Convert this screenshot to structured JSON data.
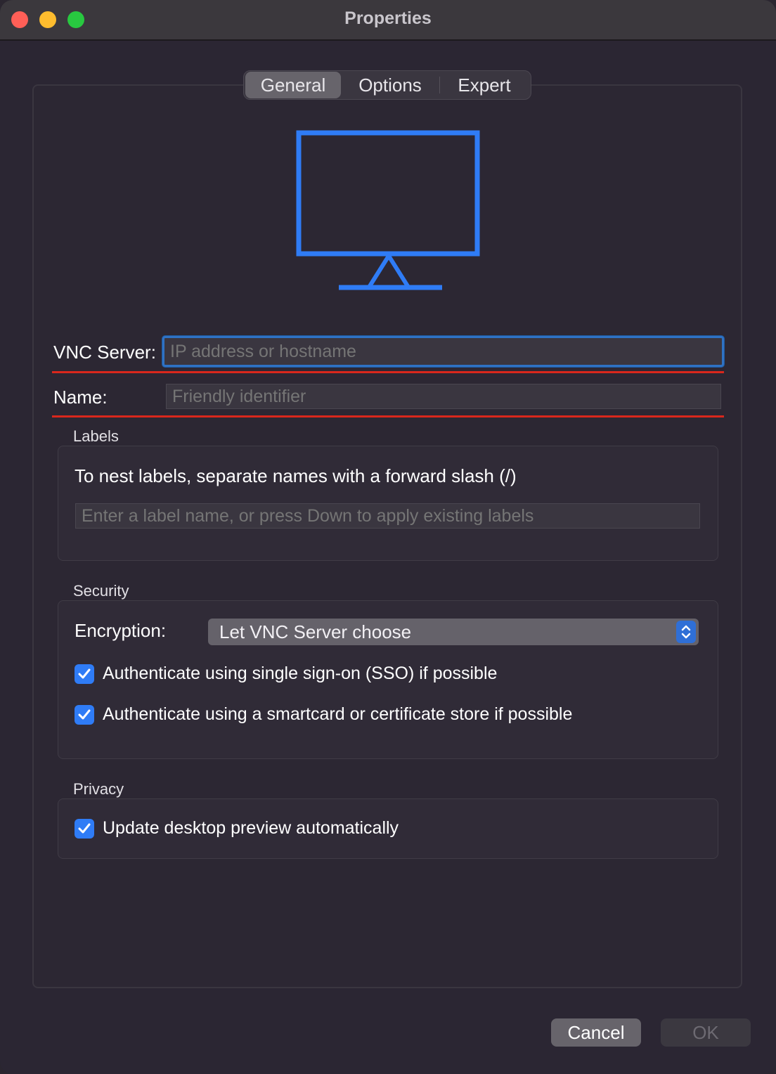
{
  "window": {
    "title": "Properties"
  },
  "tabs": [
    {
      "label": "General",
      "selected": true
    },
    {
      "label": "Options",
      "selected": false
    },
    {
      "label": "Expert",
      "selected": false
    }
  ],
  "preview_icon": "monitor-icon",
  "connection": {
    "vnc_server_label": "VNC Server:",
    "vnc_server_placeholder": "IP address or hostname",
    "vnc_server_value": "",
    "name_label": "Name:",
    "name_placeholder": "Friendly identifier",
    "name_value": ""
  },
  "labels_section": {
    "title": "Labels",
    "hint": "To nest labels, separate names with a forward slash (/)",
    "input_placeholder": "Enter a label name, or press Down to apply existing labels"
  },
  "security_section": {
    "title": "Security",
    "encryption_label": "Encryption:",
    "encryption_value": "Let VNC Server choose",
    "sso_label": "Authenticate using single sign-on (SSO) if possible",
    "sso_checked": true,
    "smartcard_label": "Authenticate using a smartcard or certificate store if possible",
    "smartcard_checked": true
  },
  "privacy_section": {
    "title": "Privacy",
    "preview_label": "Update desktop preview automatically",
    "preview_checked": true
  },
  "buttons": {
    "cancel": "Cancel",
    "ok": "OK"
  },
  "colors": {
    "accent": "#2f7cf6",
    "validation_line": "#d9271c",
    "traffic_close": "#ff5f57",
    "traffic_minimize": "#febc2e",
    "traffic_zoom": "#28c840"
  }
}
